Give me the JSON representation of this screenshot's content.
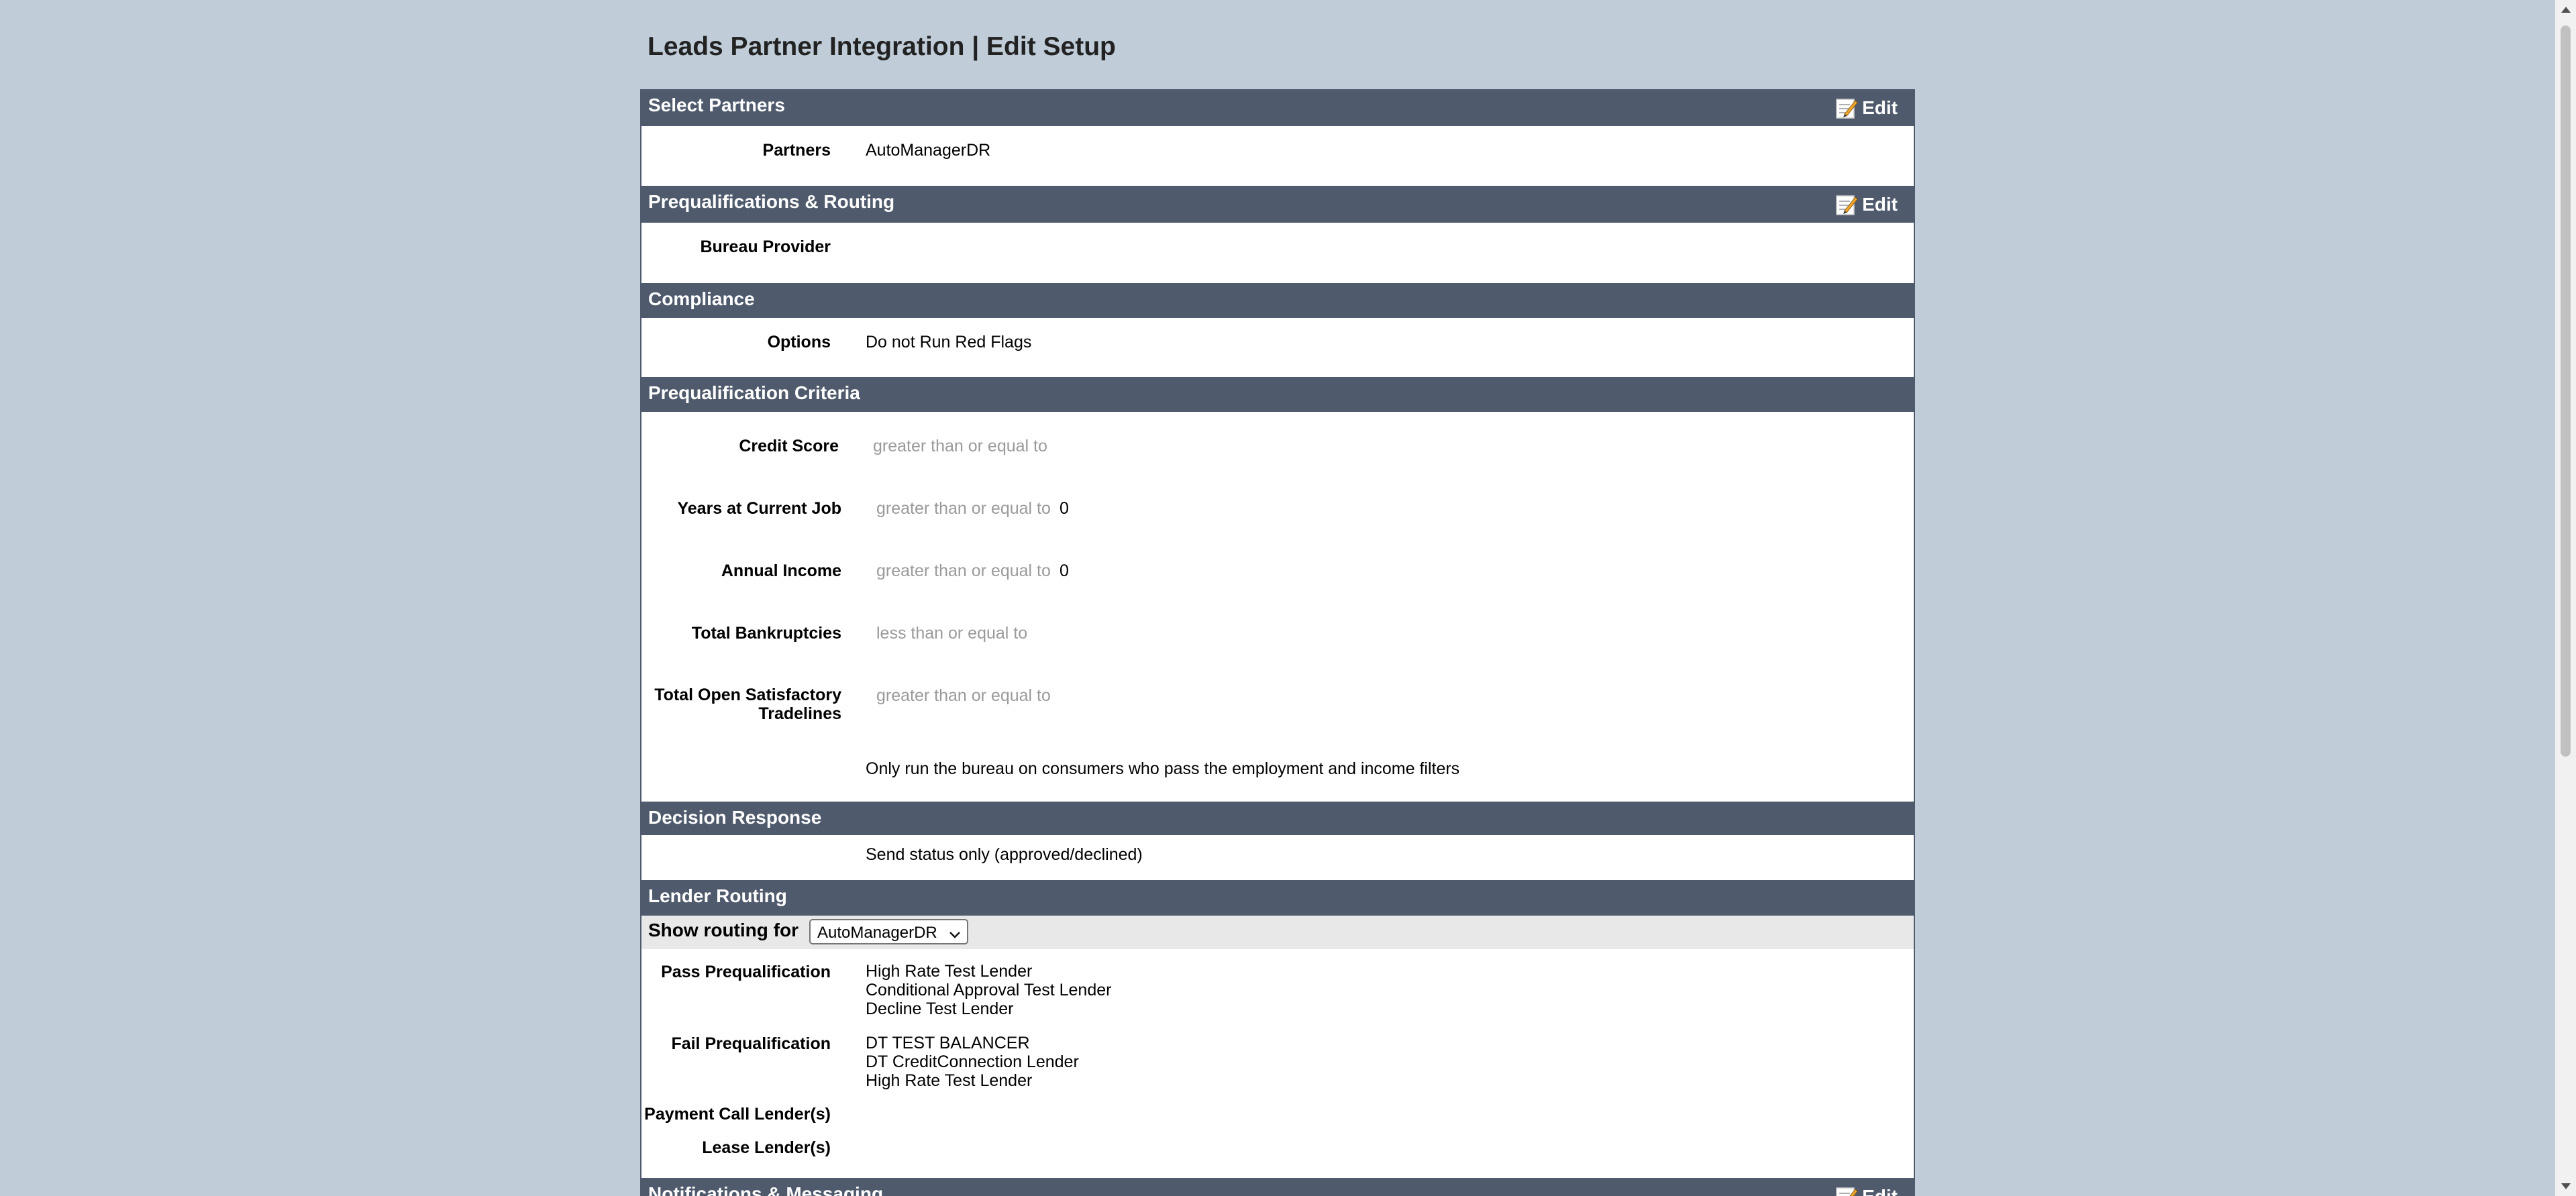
{
  "page": {
    "title": "Leads Partner Integration | Edit Setup"
  },
  "sections": {
    "select_partners": {
      "title": "Select Partners",
      "edit_label": "Edit",
      "partners_label": "Partners",
      "partners_value": "AutoManagerDR"
    },
    "prequal_routing": {
      "title": "Prequalifications & Routing",
      "edit_label": "Edit",
      "bureau_label": "Bureau Provider"
    },
    "compliance": {
      "title": "Compliance",
      "options_label": "Options",
      "options_value": "Do not Run Red Flags"
    },
    "criteria": {
      "title": "Prequalification Criteria",
      "rows": [
        {
          "label": "Credit Score",
          "operator": "greater than or equal to",
          "value": ""
        },
        {
          "label": "Years at Current Job",
          "operator": "greater than or equal to",
          "value": "0"
        },
        {
          "label": "Annual Income",
          "operator": "greater than or equal to",
          "value": "0"
        },
        {
          "label": "Total Bankruptcies",
          "operator": "less than or equal to",
          "value": ""
        },
        {
          "label_line1": "Total Open Satisfactory",
          "label_line2": "Tradelines",
          "operator": "greater than or equal to",
          "value": ""
        }
      ],
      "note": "Only run the bureau on consumers who pass the employment and income filters"
    },
    "decision": {
      "title": "Decision Response",
      "value": "Send status only (approved/declined)"
    },
    "lender_routing": {
      "title": "Lender Routing",
      "show_routing_label": "Show routing for",
      "selected": "AutoManagerDR",
      "pass_label": "Pass Prequalification",
      "pass_lenders": [
        "High Rate Test Lender",
        "Conditional Approval Test Lender",
        "Decline Test Lender"
      ],
      "fail_label": "Fail Prequalification",
      "fail_lenders": [
        "DT TEST BALANCER",
        "DT CreditConnection Lender",
        "High Rate Test Lender"
      ],
      "payment_call_label": "Payment Call Lender(s)",
      "lease_label": "Lease Lender(s)"
    },
    "notifications": {
      "title": "Notifications & Messaging",
      "edit_label": "Edit"
    }
  },
  "colors": {
    "page_background": "#c0cdd9",
    "section_header": "#4f5a6d",
    "routing_bar": "#e8e8e8",
    "placeholder_text": "#9a9a9a"
  },
  "icons": {
    "edit": "edit-note-icon",
    "select": "chevron-down-icon"
  }
}
